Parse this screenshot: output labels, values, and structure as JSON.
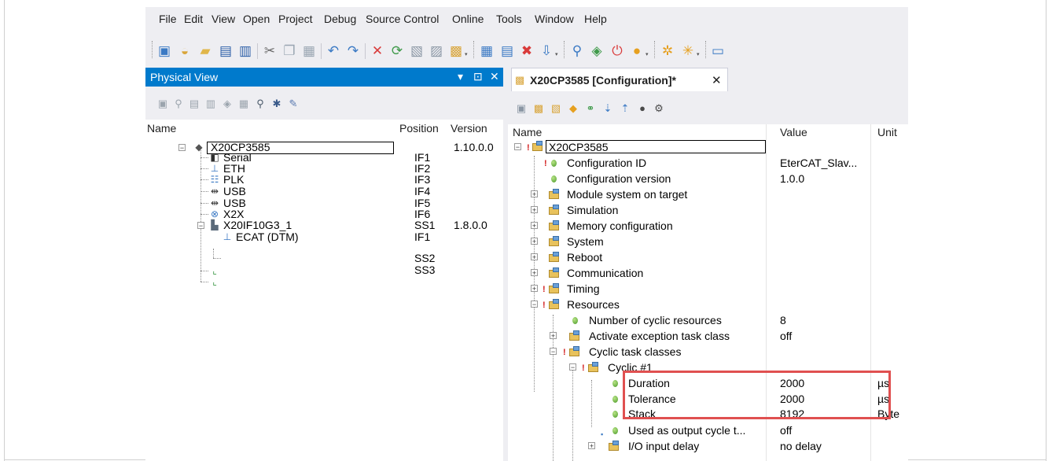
{
  "menu": [
    "File",
    "Edit",
    "View",
    "Open",
    "Project",
    "Debug",
    "Source Control",
    "Online",
    "Tools",
    "Window",
    "Help"
  ],
  "physical_view": {
    "title": "Physical View",
    "controls": [
      "▾",
      "⊡",
      "✕"
    ],
    "columns": {
      "name": "Name",
      "position": "Position",
      "version": "Version"
    },
    "rows": [
      {
        "name": "X20CP3585",
        "position": "",
        "version": "1.10.0.0",
        "icon": "cpu-icon"
      },
      {
        "name": "Serial",
        "position": "IF1",
        "version": "",
        "icon": "serial-port-icon"
      },
      {
        "name": "ETH",
        "position": "IF2",
        "version": "",
        "icon": "ethernet-icon"
      },
      {
        "name": "PLK",
        "position": "IF3",
        "version": "",
        "icon": "powerlink-icon"
      },
      {
        "name": "USB",
        "position": "IF4",
        "version": "",
        "icon": "usb-icon"
      },
      {
        "name": "USB",
        "position": "IF5",
        "version": "",
        "icon": "usb-icon"
      },
      {
        "name": "X2X",
        "position": "IF6",
        "version": "",
        "icon": "x2x-icon"
      },
      {
        "name": "X20IF10G3_1",
        "position": "SS1",
        "version": "1.8.0.0",
        "icon": "interface-module-icon"
      },
      {
        "name": "ECAT (DTM)",
        "position": "IF1",
        "version": "",
        "icon": "ethercat-icon"
      },
      {
        "name": "",
        "position": "SS2",
        "version": "",
        "icon": "slot-icon"
      },
      {
        "name": "",
        "position": "SS3",
        "version": "",
        "icon": "slot-icon"
      }
    ]
  },
  "config": {
    "tab_label": "X20CP3585 [Configuration]*",
    "tab_close": "✕",
    "columns": {
      "name": "Name",
      "value": "Value",
      "unit": "Unit"
    },
    "rows": [
      {
        "name": "X20CP3585",
        "value": "",
        "unit": ""
      },
      {
        "name": "Configuration ID",
        "value": "EterCAT_Slav...",
        "unit": ""
      },
      {
        "name": "Configuration version",
        "value": "1.0.0",
        "unit": ""
      },
      {
        "name": "Module system on target",
        "value": "",
        "unit": ""
      },
      {
        "name": "Simulation",
        "value": "",
        "unit": ""
      },
      {
        "name": "Memory configuration",
        "value": "",
        "unit": ""
      },
      {
        "name": "System",
        "value": "",
        "unit": ""
      },
      {
        "name": "Reboot",
        "value": "",
        "unit": ""
      },
      {
        "name": "Communication",
        "value": "",
        "unit": ""
      },
      {
        "name": "Timing",
        "value": "",
        "unit": ""
      },
      {
        "name": "Resources",
        "value": "",
        "unit": ""
      },
      {
        "name": "Number of cyclic resources",
        "value": "8",
        "unit": ""
      },
      {
        "name": "Activate exception task class",
        "value": "off",
        "unit": ""
      },
      {
        "name": "Cyclic task classes",
        "value": "",
        "unit": ""
      },
      {
        "name": "Cyclic #1",
        "value": "",
        "unit": ""
      },
      {
        "name": "Duration",
        "value": "2000",
        "unit": "µs"
      },
      {
        "name": "Tolerance",
        "value": "2000",
        "unit": "µs"
      },
      {
        "name": "Stack",
        "value": "8192",
        "unit": "Byte"
      },
      {
        "name": "Used as output cycle t...",
        "value": "off",
        "unit": ""
      },
      {
        "name": "I/O input delay",
        "value": "no delay",
        "unit": ""
      }
    ]
  },
  "colors": {
    "title_bar": "#007acc",
    "highlight_box": "#e05050",
    "chrome": "#eeeef2"
  }
}
